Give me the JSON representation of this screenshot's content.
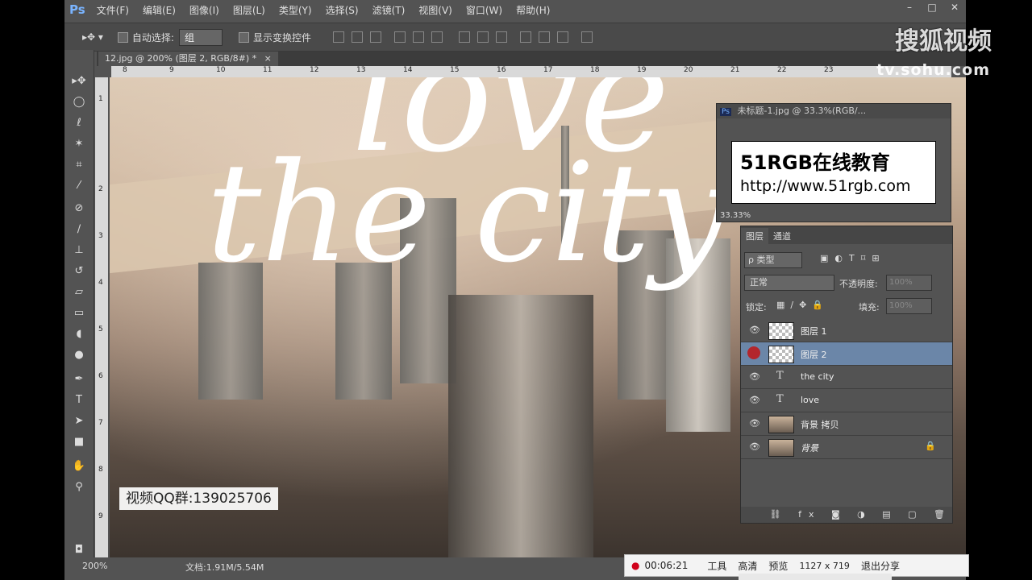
{
  "menubar": {
    "app_logo": "Ps",
    "items": [
      "文件(F)",
      "编辑(E)",
      "图像(I)",
      "图层(L)",
      "类型(Y)",
      "选择(S)",
      "滤镜(T)",
      "视图(V)",
      "窗口(W)",
      "帮助(H)"
    ],
    "window_controls": [
      "–",
      "□",
      "✕"
    ]
  },
  "options_bar": {
    "auto_select_label": "自动选择:",
    "auto_select_value": "组",
    "show_transform_label": "显示变换控件"
  },
  "document": {
    "tab_title": "12.jpg @ 200% (图层 2, RGB/8#) *",
    "canvas_text_top": "love",
    "canvas_text_main": "the city",
    "ruler_h_ticks": [
      "8",
      "9",
      "10",
      "11",
      "12",
      "13",
      "14",
      "15",
      "16",
      "17",
      "18",
      "19",
      "20",
      "21",
      "22",
      "23"
    ],
    "ruler_v_ticks": [
      "1",
      "2",
      "3",
      "4",
      "5",
      "6",
      "7",
      "8",
      "9"
    ]
  },
  "status_bar": {
    "zoom": "200%",
    "doc_info": "文档:1.91M/5.54M"
  },
  "floating_window": {
    "title": "未标题-1.jpg @ 33.3%(RGB/...",
    "brand_title": "51RGB在线教育",
    "brand_url": "http://www.51rgb.com",
    "zoom": "33.33%"
  },
  "layers_panel": {
    "tabs": [
      "图层",
      "通道"
    ],
    "filter_label": "ρ 类型",
    "blend_mode": "正常",
    "opacity_label": "不透明度:",
    "opacity_value": "100%",
    "lock_label": "锁定:",
    "fill_label": "填充:",
    "fill_value": "100%",
    "layers": [
      {
        "name": "图层 1",
        "kind": "pixel",
        "selected": false
      },
      {
        "name": "图层 2",
        "kind": "pixel",
        "selected": true
      },
      {
        "name": "the city",
        "kind": "text",
        "selected": false
      },
      {
        "name": "love",
        "kind": "text",
        "selected": false
      },
      {
        "name": "背景 拷贝",
        "kind": "photo",
        "selected": false
      },
      {
        "name": "背景",
        "kind": "photo",
        "selected": false
      }
    ],
    "footer_icons": [
      "link-icon",
      "fx-icon",
      "mask-icon",
      "adjustment-icon",
      "folder-icon",
      "new-layer-icon",
      "trash-icon"
    ]
  },
  "watermarks": {
    "sohu_logo": "搜狐视频",
    "sohu_url": "tv.sohu.com",
    "qq_group": "视频QQ群:139025706"
  },
  "recorder_bar": {
    "time": "00:06:21",
    "tools": "工具",
    "quality": "高清",
    "preview": "预览",
    "resolution": "1127 x 719",
    "exit": "退出分享"
  },
  "colors": {
    "ps_panel": "#535353",
    "selected_layer": "#6b86a8",
    "bg_swatch": "#38c6e8",
    "recording_dot": "#d0021b"
  }
}
